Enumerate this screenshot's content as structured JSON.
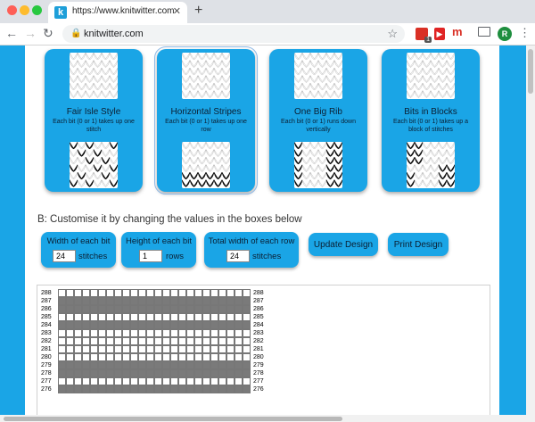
{
  "browser": {
    "tab_title": "https://www.knitwitter.com",
    "favicon_letter": "k",
    "url": "knitwitter.com",
    "profile_initial": "R",
    "extension_badge": "1",
    "extension_letter": "m"
  },
  "patterns": [
    {
      "title": "Fair Isle Style",
      "description": "Each bit (0 or 1) takes up one stitch",
      "selected": false
    },
    {
      "title": "Horizontal Stripes",
      "description": "Each bit (0 or 1) takes up one row",
      "selected": true
    },
    {
      "title": "One Big Rib",
      "description": "Each bit (0 or 1) runs down vertically",
      "selected": false
    },
    {
      "title": "Bits in Blocks",
      "description": "Each bit (0 or 1) takes up a block of stitches",
      "selected": false
    }
  ],
  "customise": {
    "heading": "B: Customise it by changing the values in the boxes below",
    "bit_width": {
      "label": "Width of each bit",
      "value": "24",
      "unit": "stitches"
    },
    "bit_height": {
      "label": "Height of each bit",
      "value": "1",
      "unit": "rows"
    },
    "row_width": {
      "label": "Total width of each row",
      "value": "24",
      "unit": "stitches"
    },
    "update_label": "Update Design",
    "print_label": "Print Design"
  },
  "grid": {
    "columns": 24,
    "rows": [
      {
        "label": "288",
        "filled": false
      },
      {
        "label": "287",
        "filled": true
      },
      {
        "label": "286",
        "filled": true
      },
      {
        "label": "285",
        "filled": false
      },
      {
        "label": "284",
        "filled": true
      },
      {
        "label": "283",
        "filled": false
      },
      {
        "label": "282",
        "filled": false
      },
      {
        "label": "281",
        "filled": false
      },
      {
        "label": "280",
        "filled": false
      },
      {
        "label": "279",
        "filled": true
      },
      {
        "label": "278",
        "filled": true
      },
      {
        "label": "277",
        "filled": false
      },
      {
        "label": "276",
        "filled": true
      }
    ],
    "fill_color": "#7a7a7a"
  },
  "colors": {
    "accent": "#1aa5e6",
    "knit_dark": "#111111",
    "knit_light": "#ffffff"
  }
}
